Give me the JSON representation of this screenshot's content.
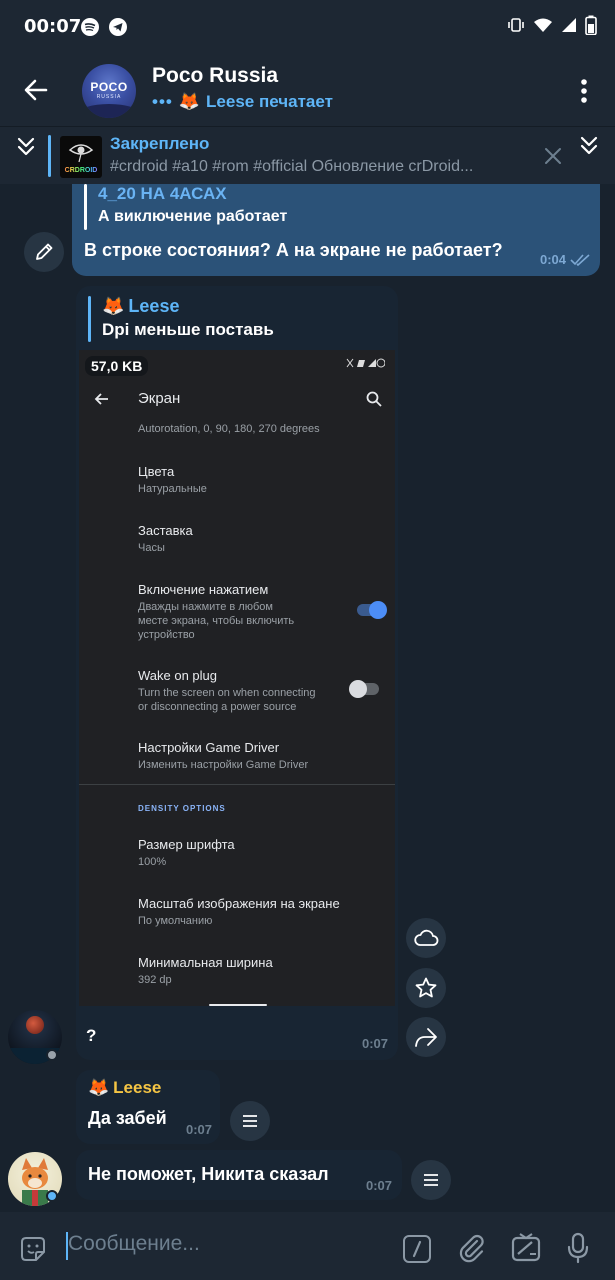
{
  "status_bar": {
    "time": "00:07",
    "left_icons": [
      "spotify-icon",
      "telegram-icon"
    ],
    "right_icons": [
      "vibrate-icon",
      "wifi-icon",
      "signal-icon",
      "battery-icon"
    ]
  },
  "header": {
    "title": "Poco Russia",
    "status": "Leese печатает",
    "avatar_text": "POCO",
    "avatar_subtext": "RUSSIA"
  },
  "pinned": {
    "title": "Закреплено",
    "text": "#crdroid #a10 #rom #official  Обновление crDroid...",
    "thumb_text": "CRDROID"
  },
  "messages": {
    "m1": {
      "quote_name": "4_20 НА 4АСАХ",
      "quote_text": "А виключение работает",
      "text": "В строке состояния? А на экране не работает?",
      "time": "0:04"
    },
    "m2": {
      "quote_name": "Leese",
      "quote_text": "Dpi меньше поставь",
      "size": "57,0 KB",
      "caption": "?",
      "time": "0:07"
    },
    "m3": {
      "name": "Leese",
      "text": "Да забей",
      "time": "0:07"
    },
    "m4": {
      "text": "Не поможет, Никита сказал",
      "time": "0:07"
    }
  },
  "screenshot": {
    "title": "Экран",
    "autorotation": "Autorotation, 0, 90, 180, 270 degrees",
    "items": [
      {
        "title": "Цвета",
        "subtitle": "Натуральные"
      },
      {
        "title": "Заставка",
        "subtitle": "Часы"
      },
      {
        "title": "Включение нажатием",
        "subtitle1": "Дважды нажмите в любом",
        "subtitle2": "месте экрана, чтобы включить",
        "subtitle3": "устройство",
        "toggle": true
      },
      {
        "title": "Wake on plug",
        "subtitle1": "Turn the screen on when connecting",
        "subtitle2": "or disconnecting a power source",
        "toggle": false
      },
      {
        "title": "Настройки Game Driver",
        "subtitle": "Изменить настройки Game Driver"
      },
      {
        "title": "Размер шрифта",
        "subtitle": "100%"
      },
      {
        "title": "Масштаб изображения на экране",
        "subtitle": "По умолчанию"
      },
      {
        "title": "Минимальная ширина",
        "subtitle": "392 dp"
      }
    ],
    "section": "DENSITY OPTIONS"
  },
  "input": {
    "placeholder": "Сообщение..."
  },
  "colors": {
    "background": "#18222d",
    "header": "#1d2733",
    "bubble_out": "#2b5278",
    "bubble_in": "#182533",
    "accent": "#5eb5f7"
  }
}
